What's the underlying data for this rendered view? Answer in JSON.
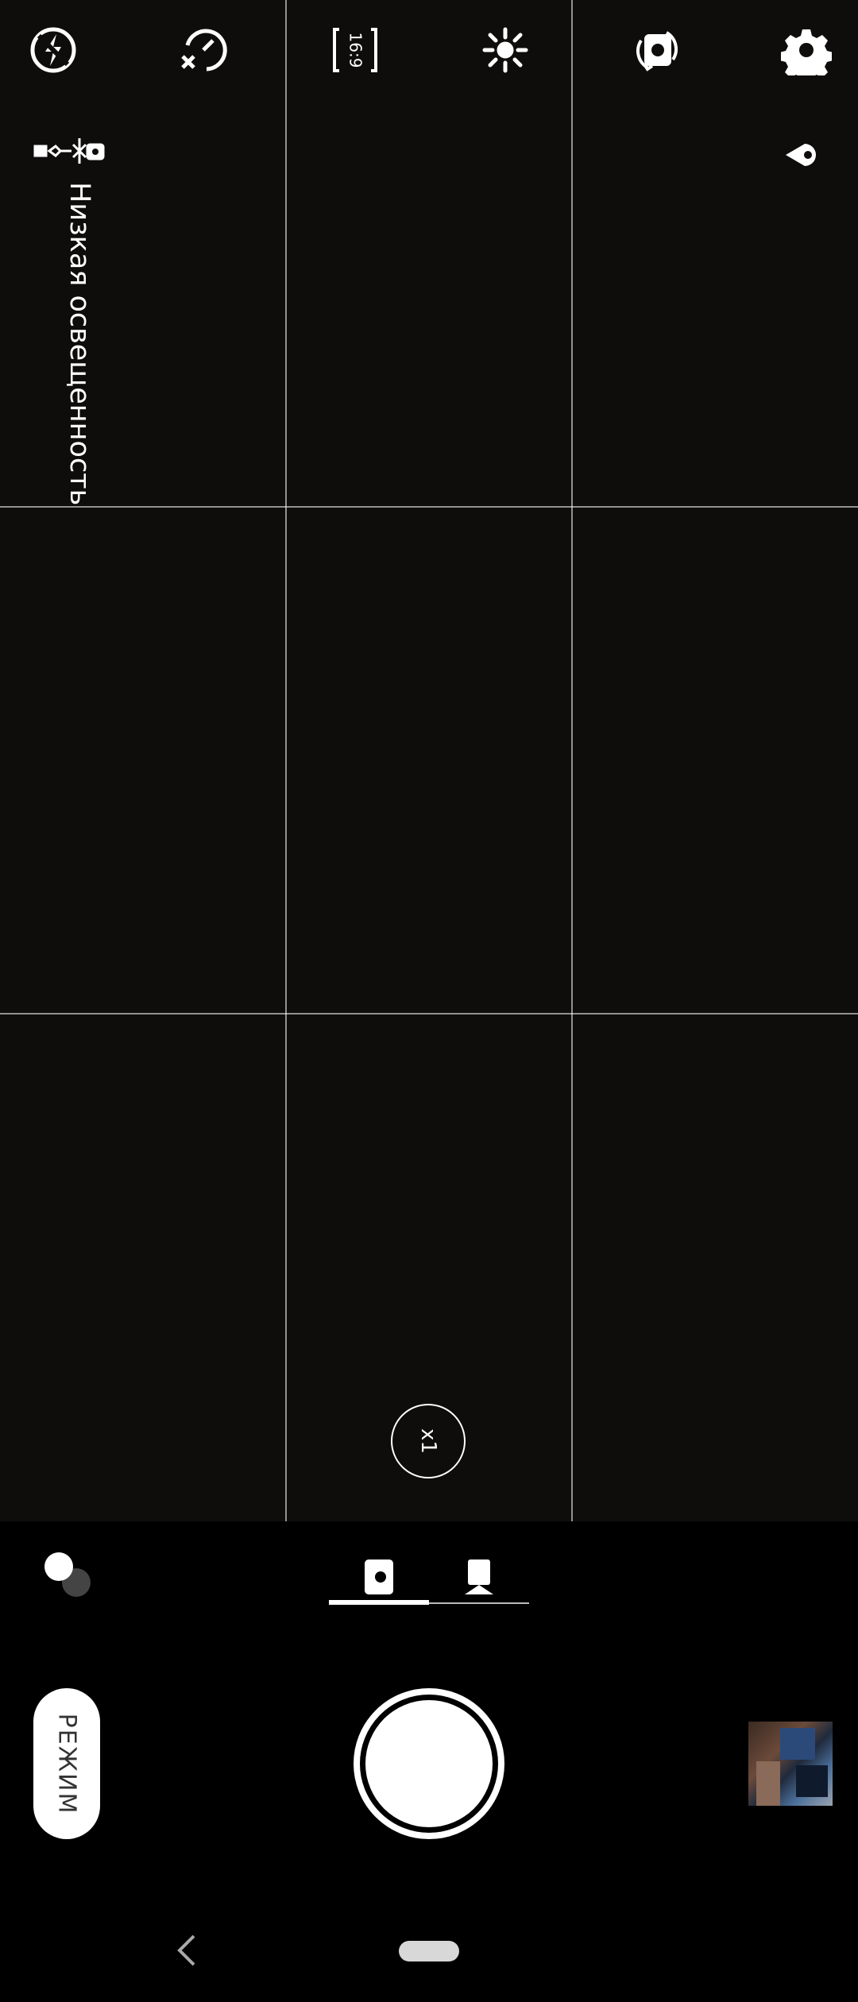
{
  "status": {
    "low_light_label": "Низкая освещенность"
  },
  "top_toolbar": {
    "aspect_ratio": "16:9",
    "icons": [
      "flash-icon",
      "timer-off-icon",
      "aspect-ratio-icon",
      "brightness-icon",
      "switch-camera-icon",
      "settings-icon"
    ]
  },
  "zoom": {
    "label": "x1"
  },
  "mode_tabs": {
    "items": [
      "photo-mode-icon",
      "video-mode-icon"
    ],
    "active": "photo-mode-icon"
  },
  "controls": {
    "mode_label": "РЕЖИМ"
  },
  "colors": {
    "viewfinder": "#0f0d0c",
    "background": "#000000",
    "foreground": "#ffffff"
  }
}
